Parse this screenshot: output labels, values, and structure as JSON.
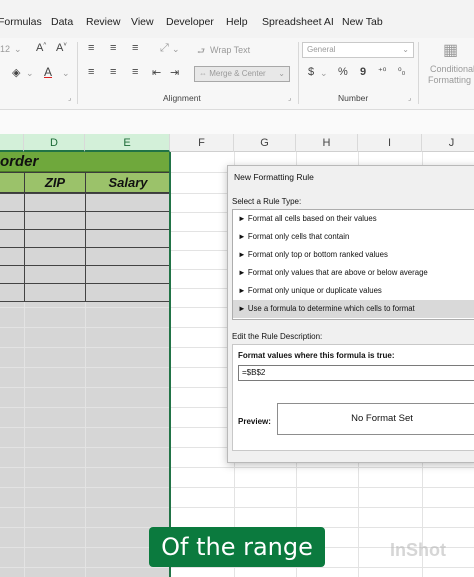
{
  "menu_tabs": [
    "Formulas",
    "Data",
    "Review",
    "View",
    "Developer",
    "Help",
    "Spreadsheet AI",
    "New Tab"
  ],
  "ribbon": {
    "font_size": "12",
    "wrap_text": "Wrap Text",
    "merge_center": "Merge & Center",
    "number_format": "General",
    "currency": "$",
    "percent": "%",
    "comma": "9",
    "conditional_formatting": [
      "Conditional",
      "Formatting"
    ],
    "alignment_label": "Alignment",
    "number_label": "Number"
  },
  "columns": [
    "D",
    "E",
    "F",
    "G",
    "H",
    "I",
    "J"
  ],
  "sheet": {
    "title": "order",
    "headers": [
      "ZIP",
      "Salary"
    ]
  },
  "dialog": {
    "title": "New Formatting Rule",
    "select_label": "Select a Rule Type:",
    "rule_types": [
      "► Format all cells based on their values",
      "► Format only cells that contain",
      "► Format only top or bottom ranked values",
      "► Format only values that are above or below average",
      "► Format only unique or duplicate values",
      "► Use a formula to determine which cells to format"
    ],
    "edit_label": "Edit the Rule Description:",
    "formula_label": "Format values where this formula is true:",
    "formula_value": "=$B$2",
    "preview_label": "Preview:",
    "preview_text": "No Format Set"
  },
  "caption": "Of the range",
  "colors": {
    "title_fill": "#6fa83c",
    "header_fill": "#9bc26a",
    "selection_border": "#217346",
    "caption_bg": "#0b7a3e"
  }
}
